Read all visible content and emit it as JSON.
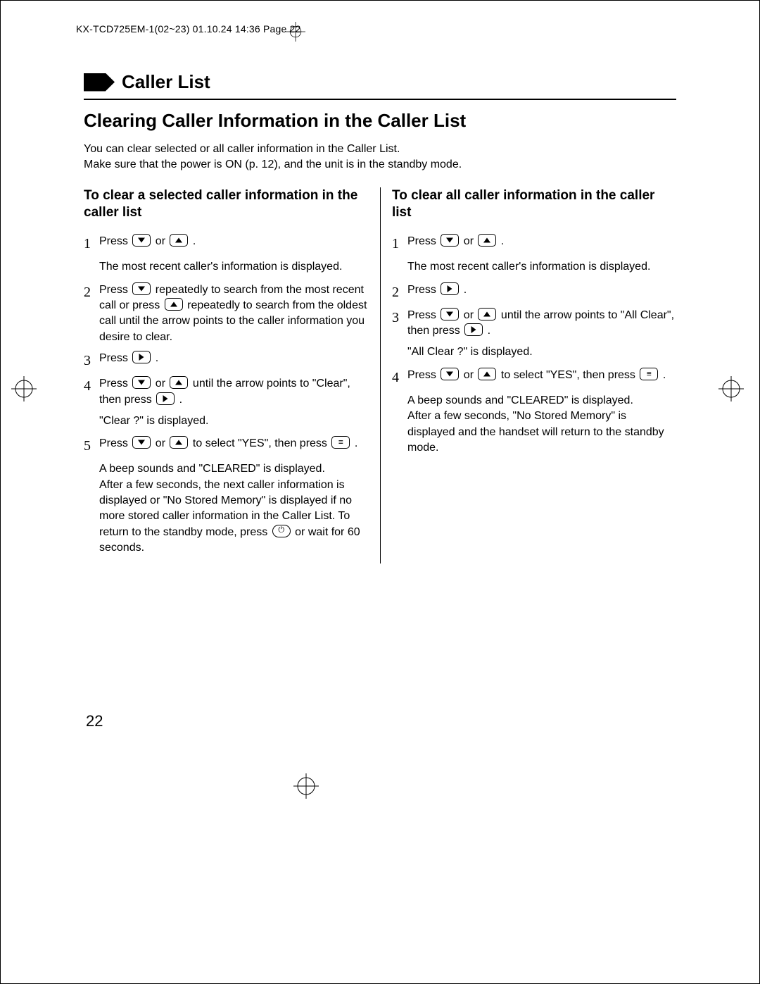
{
  "slug": "KX-TCD725EM-1(02~23)  01.10.24 14:36  Page 22",
  "section_title": "Caller List",
  "h2": "Clearing Caller Information in the Caller List",
  "intro_line1": "You can clear selected or all caller information in the Caller List.",
  "intro_line2": "Make sure that the power is ON (p. 12), and the unit is in the standby mode.",
  "left": {
    "subhead": "To clear a selected caller information in the caller list",
    "s1_a": "Press ",
    "s1_b": " or ",
    "s1_c": ".",
    "n1": "The most recent caller's information is displayed.",
    "s2_a": "Press ",
    "s2_b": " repeatedly to search from the most recent call or press ",
    "s2_c": " repeatedly to search from the oldest call until the arrow points to the caller information you desire to clear.",
    "s3_a": "Press ",
    "s3_b": ".",
    "s4_a": "Press ",
    "s4_b": " or ",
    "s4_c": " until the arrow points to \"Clear\", then press ",
    "s4_d": ".",
    "n4": "\"Clear ?\" is displayed.",
    "s5_a": "Press ",
    "s5_b": " or ",
    "s5_c": " to select \"YES\", then press ",
    "s5_d": ".",
    "n5": "A beep sounds and \"CLEARED\" is displayed.\nAfter a few seconds, the next caller information is displayed or \"No Stored Memory\" is displayed if no more stored caller information in the Caller List. To return to the standby mode, press ",
    "n5_tail": " or wait for 60 seconds."
  },
  "right": {
    "subhead": "To clear all caller information in the caller list",
    "s1_a": "Press ",
    "s1_b": " or ",
    "s1_c": ".",
    "n1": "The most recent caller's information is displayed.",
    "s2_a": "Press ",
    "s2_b": ".",
    "s3_a": "Press ",
    "s3_b": " or ",
    "s3_c": " until the arrow points to \"All Clear\", then press ",
    "s3_d": ".",
    "n3": "\"All Clear ?\" is displayed.",
    "s4_a": "Press ",
    "s4_b": " or ",
    "s4_c": " to select \"YES\", then press ",
    "s4_d": ".",
    "n4": "A beep sounds and \"CLEARED\" is displayed.\nAfter a few seconds, \"No Stored Memory\" is displayed and the handset will return to the standby mode."
  },
  "page_number": "22"
}
